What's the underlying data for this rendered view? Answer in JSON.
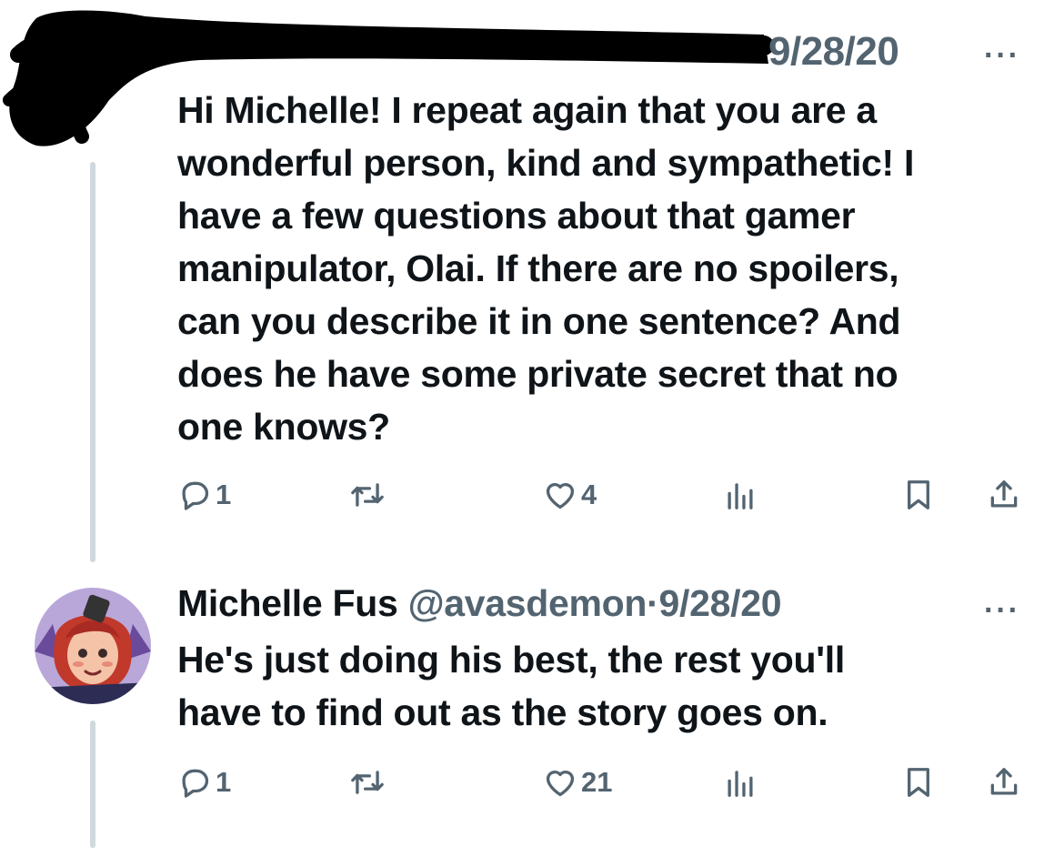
{
  "tweet1": {
    "date": "9/28/20",
    "more_label": "···",
    "text": "Hi Michelle! I repeat again that you are a wonderful person, kind and sympathetic! I have a few questions about that gamer manipulator, Olai. If there are no spoilers, can you describe it in one sentence? And does he have some private secret that no one knows?",
    "lines": [
      "Hi Michelle! I repeat again that you are a",
      "wonderful person, kind and sympathetic! I",
      "have a few questions about that gamer",
      "manipulator, Olai. If there are no spoilers,",
      "can you describe it in one sentence? And",
      "does he have some private secret that no",
      "one knows?"
    ],
    "replies": "1",
    "likes": "4"
  },
  "tweet2": {
    "author_name": "Michelle Fus",
    "handle": "@avasdemon",
    "separator": "·",
    "date": "9/28/20",
    "more_label": "···",
    "text": "He's just doing his best, the rest you'll have to find out as the story goes on.",
    "lines": [
      "He's just doing his best, the rest you'll",
      "have to find out as the story goes on."
    ],
    "replies": "1",
    "likes": "21"
  },
  "icons": {
    "reply": "reply-icon",
    "retweet": "retweet-icon",
    "like": "heart-icon",
    "views": "views-icon",
    "bookmark": "bookmark-icon",
    "share": "share-icon"
  },
  "colors": {
    "text": "#0f1419",
    "secondary": "#536471",
    "thread_line": "#cfd9de",
    "redaction": "#000000"
  }
}
